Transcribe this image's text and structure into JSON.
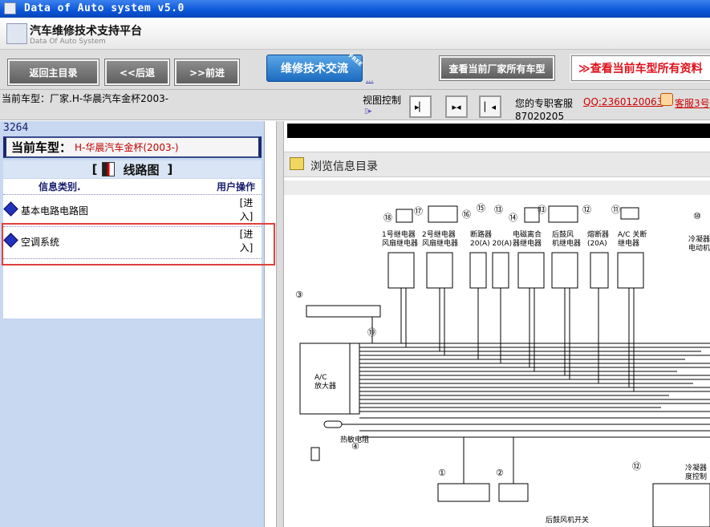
{
  "window": {
    "title": "Data of Auto system v5.0"
  },
  "header": {
    "app_name": "汽车维修技术支持平台",
    "app_subtitle": "Data Of Auto System"
  },
  "toolbar": {
    "home": "返回主目录",
    "back": "<<后退",
    "forward": ">>前进",
    "tech_exchange": "维修技术交流",
    "tech_exchange_badge": "FREE",
    "dots_link": "...",
    "all_models": "查看当前厂家所有车型",
    "all_data": "≫查看当前车型所有资料"
  },
  "status": {
    "current_model": "当前车型：厂家.H-华晨汽车金杯2003-",
    "view_control": "视图控制",
    "view_mini": "▯▸",
    "view_buttons": [
      "▸▏",
      "▸◂",
      "▏◂"
    ],
    "service_label": "您的专职客服",
    "service_qq": "QQ:2360120063",
    "service_kf": "客服3号",
    "service_phone": "87020205"
  },
  "left_panel": {
    "code": "3264",
    "model_label": "当前车型：",
    "model_value": "H-华晨汽车金杯(2003-)",
    "section_title": "线路图",
    "bracket_open": "[",
    "bracket_close": "]",
    "col_category": "信息类别.",
    "col_action": "用户操作",
    "items": [
      {
        "label": "基本电路电路图",
        "action": "[进入]"
      },
      {
        "label": "空调系统",
        "action": "[进入]"
      }
    ]
  },
  "right_panel": {
    "browse_title": "浏览信息目录",
    "diagram": {
      "relays": [
        "1号继电器\n风扇继电器",
        "2号继电器\n风扇继电器",
        "断路器\n20(A)  20(A)",
        "电磁离合\n器继电器",
        "后鼓风\n机继电器",
        "熔断器\n(20A)",
        "A/C 关断\n继电器",
        "冷凝器\n电动机"
      ],
      "amp_label": "A/C\n放大器",
      "thermistor": "热敏电阻",
      "fan_switch": "后鼓风机开关",
      "condenser_temp": "冷凝器\n度控制",
      "numbers": [
        "⑱",
        "⑰",
        "⑯",
        "⑮",
        "⑬",
        "⑭",
        "⑬",
        "⑫",
        "⑪",
        "⑩",
        "③",
        "⑲",
        "④",
        "①",
        "②",
        "⑫"
      ]
    }
  }
}
